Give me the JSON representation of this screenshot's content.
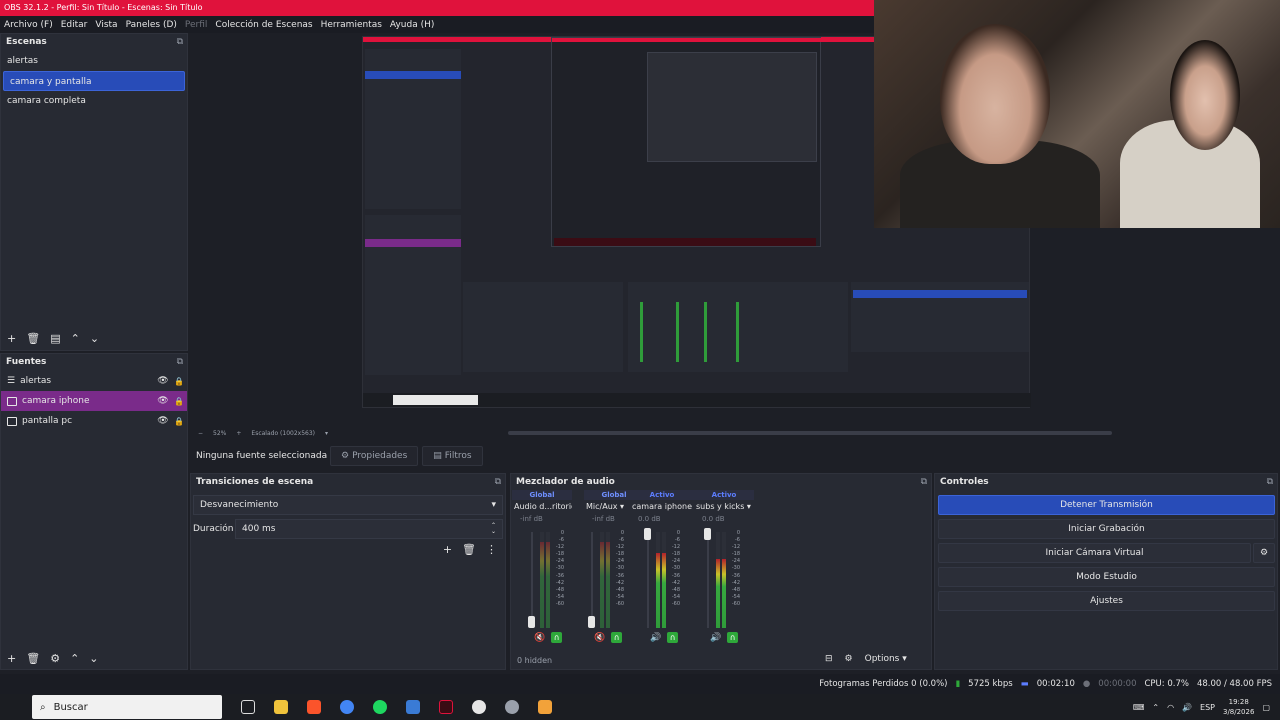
{
  "window": {
    "title": "OBS 32.1.2 - Perfil: Sin Título - Escenas: Sin Título"
  },
  "menu": [
    {
      "label": "Archivo (F)",
      "enabled": true
    },
    {
      "label": "Editar",
      "enabled": true
    },
    {
      "label": "Vista",
      "enabled": true
    },
    {
      "label": "Paneles (D)",
      "enabled": true
    },
    {
      "label": "Perfil",
      "enabled": false
    },
    {
      "label": "Colección de Escenas",
      "enabled": true
    },
    {
      "label": "Herramientas",
      "enabled": true
    },
    {
      "label": "Ayuda (H)",
      "enabled": true
    }
  ],
  "scenes": {
    "title": "Escenas",
    "items": [
      "alertas",
      "camara y pantalla",
      "camara completa"
    ],
    "selected_index": 1
  },
  "sources": {
    "title": "Fuentes",
    "items": [
      "alertas",
      "camara iphone",
      "pantalla pc"
    ],
    "selected_index": 1
  },
  "preview": {
    "zoom_label": "52%",
    "scaling_label": "Escalado (1002x563)"
  },
  "context_bar": {
    "no_source": "Ninguna fuente seleccionada",
    "properties": "Propiedades",
    "filters": "Filtros"
  },
  "transitions": {
    "title": "Transiciones de escena",
    "selected": "Desvanecimiento",
    "duration_label": "Duración",
    "duration_value": "400 ms"
  },
  "mixer": {
    "title": "Mezclador de audio",
    "hidden_label": "0 hidden",
    "options_label": "Options",
    "channels": [
      {
        "mode": "Global",
        "name": "Audio d...ritorio",
        "db": "-inf dB",
        "level": 0.0,
        "muted": true
      },
      {
        "mode": "Global",
        "name": "Mic/Aux",
        "db": "-inf dB",
        "level": 0.0,
        "muted": true
      },
      {
        "mode": "Activo",
        "name": "camara iphone",
        "db": "0.0 dB",
        "level": 0.78,
        "muted": false
      },
      {
        "mode": "Activo",
        "name": "subs y kicks",
        "db": "0.0 dB",
        "level": 0.72,
        "muted": false
      }
    ],
    "scale": [
      "0",
      "-6",
      "-12",
      "-18",
      "-24",
      "-30",
      "-36",
      "-42",
      "-48",
      "-54",
      "-60"
    ]
  },
  "controls": {
    "title": "Controles",
    "buttons": [
      "Detener Transmisión",
      "Iniciar Grabación",
      "Iniciar Cámara Virtual",
      "Modo Estudio",
      "Ajustes"
    ]
  },
  "status": {
    "dropped": "Fotogramas Perdidos 0 (0.0%)",
    "bitrate": "5725 kbps",
    "stream_time": "00:02:10",
    "rec_time": "00:00:00",
    "cpu": "CPU: 0.7%",
    "fps": "48.00 / 48.00 FPS"
  },
  "taskbar": {
    "search_placeholder": "Buscar",
    "lang": "ESP",
    "time": "19:28",
    "date": "3/8/2026"
  },
  "colors": {
    "accent": "#284cb8",
    "title_bar": "#e0123c",
    "source_selected": "#7a2b8a",
    "meter_green": "#2f9c3a"
  }
}
